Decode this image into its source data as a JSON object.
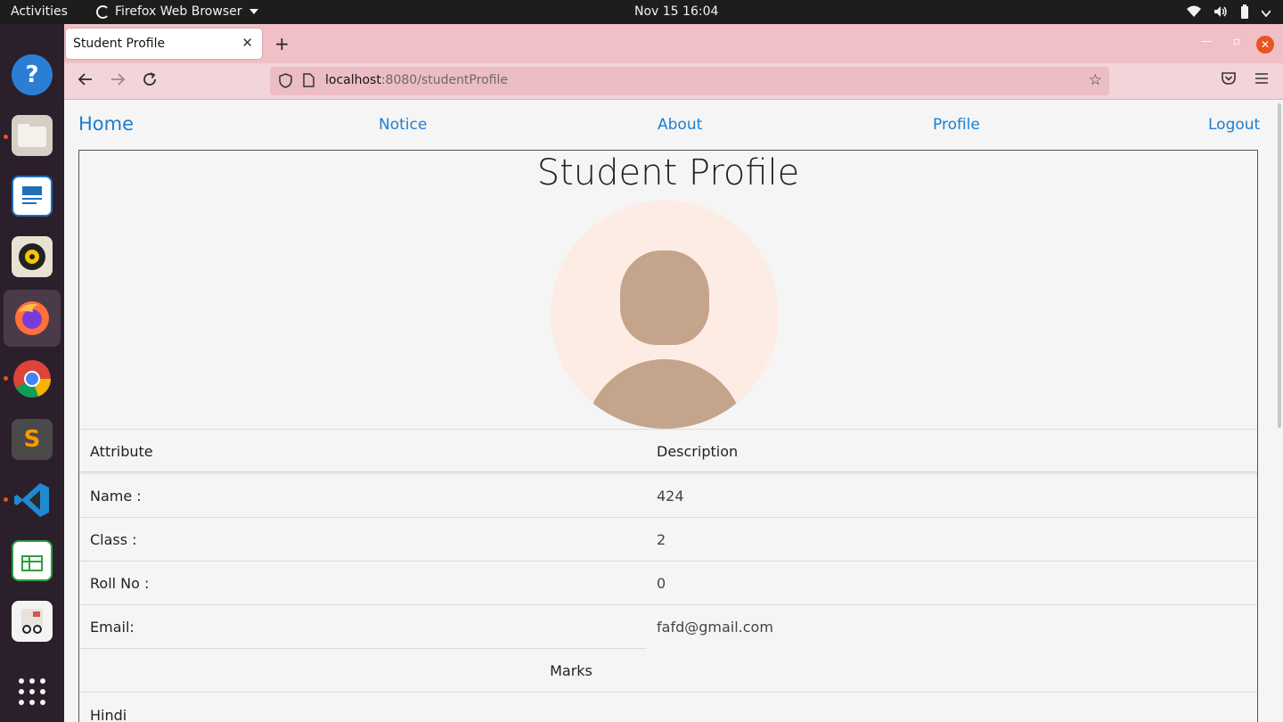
{
  "system": {
    "activities": "Activities",
    "app_name": "Firefox Web Browser",
    "clock": "Nov 15  16:04"
  },
  "browser": {
    "tab_title": "Student Profile",
    "url_host": "localhost",
    "url_rest": ":8080/studentProfile"
  },
  "site_nav": {
    "home": "Home",
    "notice": "Notice",
    "about": "About",
    "profile": "Profile",
    "logout": "Logout"
  },
  "profile": {
    "title": "Student Profile",
    "table_header": {
      "attribute": "Attribute",
      "description": "Description"
    },
    "rows": [
      {
        "label": "Name :",
        "value": "424"
      },
      {
        "label": "Class :",
        "value": "2"
      },
      {
        "label": "Roll No :",
        "value": "0"
      },
      {
        "label": "Email:",
        "value": "fafd@gmail.com"
      }
    ],
    "marks_label": "Marks",
    "subjects": [
      "Hindi"
    ]
  },
  "colors": {
    "link": "#1b7fd1",
    "tabbar": "#f0c0c6",
    "avatar_bg": "#fdece4",
    "avatar_fg": "#c4a48b"
  }
}
